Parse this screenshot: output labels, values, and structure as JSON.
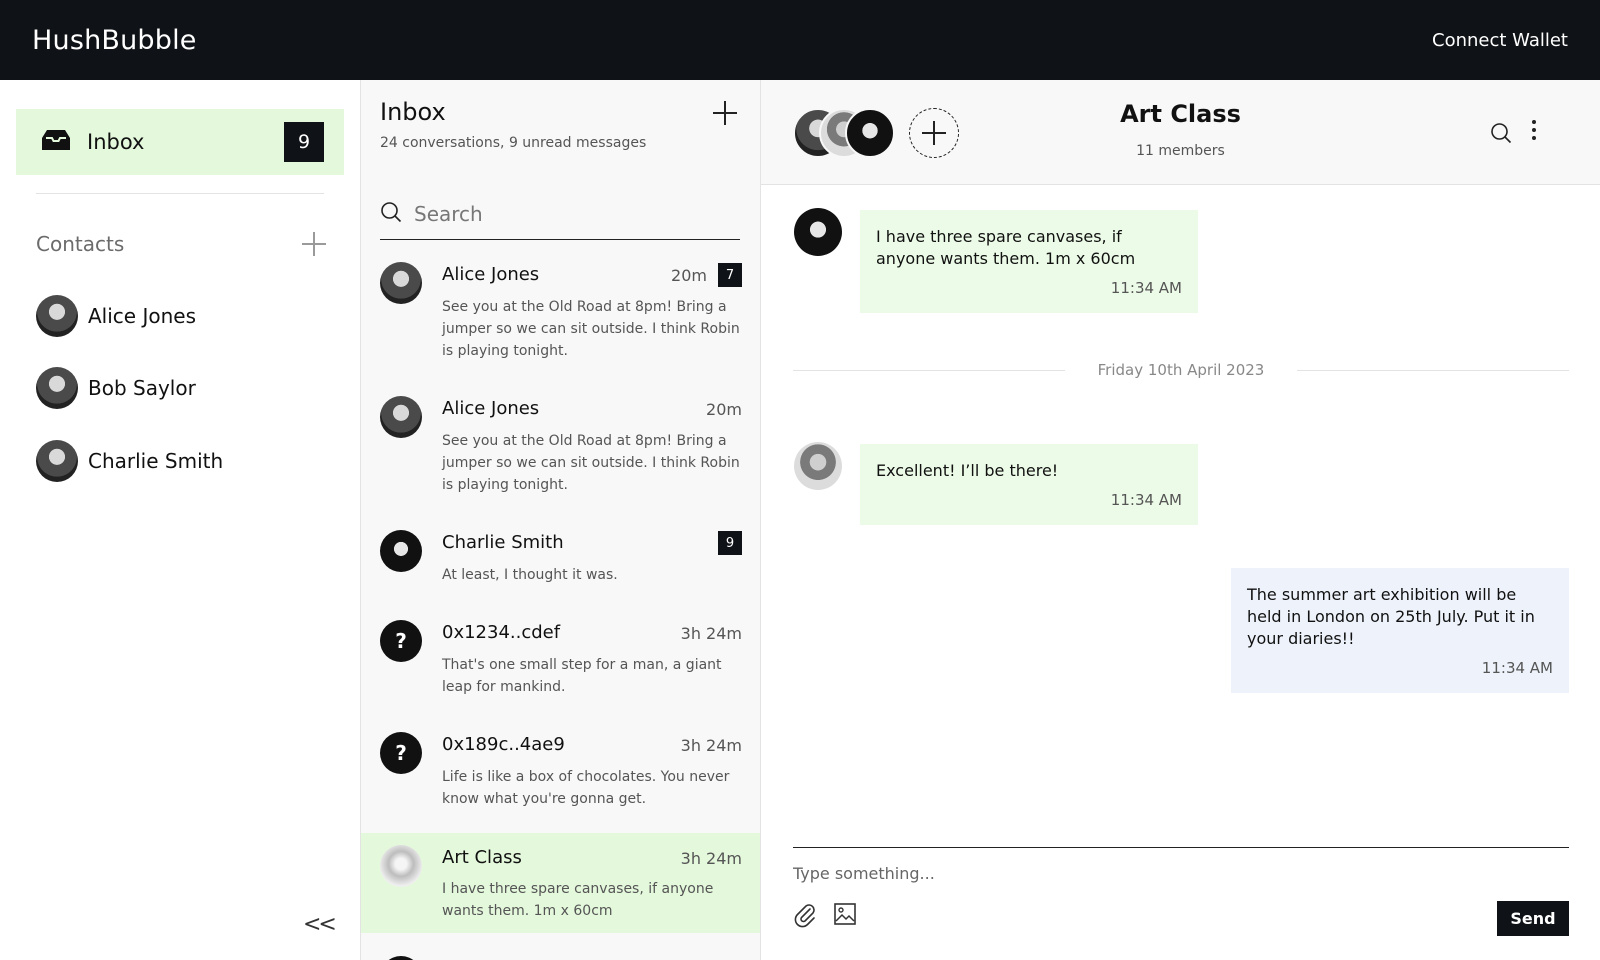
{
  "header": {
    "brand": "HushBubble",
    "wallet_label": "Connect Wallet"
  },
  "sidebar": {
    "inbox_label": "Inbox",
    "inbox_count": "9",
    "contacts_title": "Contacts",
    "contacts": [
      {
        "name": "Alice Jones"
      },
      {
        "name": "Bob Saylor"
      },
      {
        "name": "Charlie Smith"
      }
    ],
    "collapse_glyph": "<<"
  },
  "conversations": {
    "title": "Inbox",
    "subtitle": "24 conversations, 9 unread messages",
    "search_placeholder": "Search",
    "items": [
      {
        "name": "Alice Jones",
        "time": "20m",
        "badge": "7",
        "preview": "See you at the Old Road at 8pm! Bring a jumper so we can sit outside. I think Robin is playing tonight."
      },
      {
        "name": "Alice Jones",
        "time": "20m",
        "preview": "See you at the Old Road at 8pm! Bring a jumper so we can sit outside. I think Robin is playing tonight."
      },
      {
        "name": "Charlie Smith",
        "badge": "9",
        "preview": "At least, I thought it was."
      },
      {
        "name": "0x1234..cdef",
        "time": "3h 24m",
        "avatar_text": "?",
        "preview": "That's one small step for a man, a giant leap for mankind."
      },
      {
        "name": "0x189c..4ae9",
        "time": "3h 24m",
        "avatar_text": "?",
        "preview": "Life is like a box of chocolates. You never know what you're gonna get."
      },
      {
        "name": "Art Class",
        "time": "3h 24m",
        "preview": "I have three spare canvases, if anyone wants them.  1m x 60cm"
      }
    ]
  },
  "chat": {
    "title": "Art Class",
    "members": "11 members",
    "messages": [
      {
        "text": "I have three spare canvases, if anyone wants them.  1m x 60cm",
        "time": "11:34 AM"
      },
      {
        "text": "Excellent! I’ll be there!",
        "time": "11:34 AM"
      },
      {
        "text": "The summer art exhibition will be held in London on 25th July.  Put it in your diaries!!",
        "time": "11:34 AM"
      }
    ],
    "date_separator": "Friday 10th April 2023",
    "composer_placeholder": "Type something...",
    "send_label": "Send"
  },
  "colors": {
    "accent": "#e4f8dc",
    "incoming_bubble": "#ecfbe7",
    "outgoing_bubble": "#eef3fb",
    "dark": "#0f1216"
  }
}
